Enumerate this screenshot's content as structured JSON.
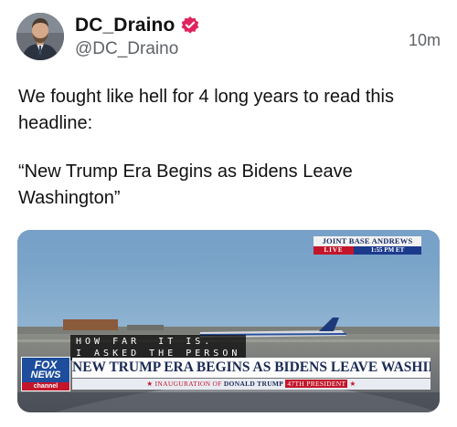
{
  "post": {
    "author": {
      "display_name": "DC_Draino",
      "handle": "@DC_Draino",
      "verified_icon": "verified-badge-icon",
      "avatar": "profile-photo"
    },
    "timestamp": "10m",
    "text_paragraphs": [
      "We fought like hell for 4 long years to read this headline:",
      "“New Trump Era Begins as Bidens Leave Washington”"
    ]
  },
  "media": {
    "bug": {
      "location": "JOINT BASE ANDREWS",
      "live": "LIVE",
      "time": "1:55 PM ET"
    },
    "caption_lines": [
      "HOW FAR  IT IS.",
      "I ASKED THE PERSON"
    ],
    "logo": {
      "line1": "FOX",
      "line2": "NEWS",
      "line3": "channel"
    },
    "headline": "NEW TRUMP ERA BEGINS AS BIDENS LEAVE WASHINGTON",
    "ticker": {
      "prefix": "★ INAUGURATION OF ",
      "name": "DONALD TRUMP",
      "tag": "47TH PRESIDENT",
      "suffix": " ★"
    }
  },
  "colors": {
    "verified": "#e0245e",
    "fox_blue": "#1d4d9c",
    "fox_red": "#c3162a",
    "text_secondary": "#5f6368"
  }
}
